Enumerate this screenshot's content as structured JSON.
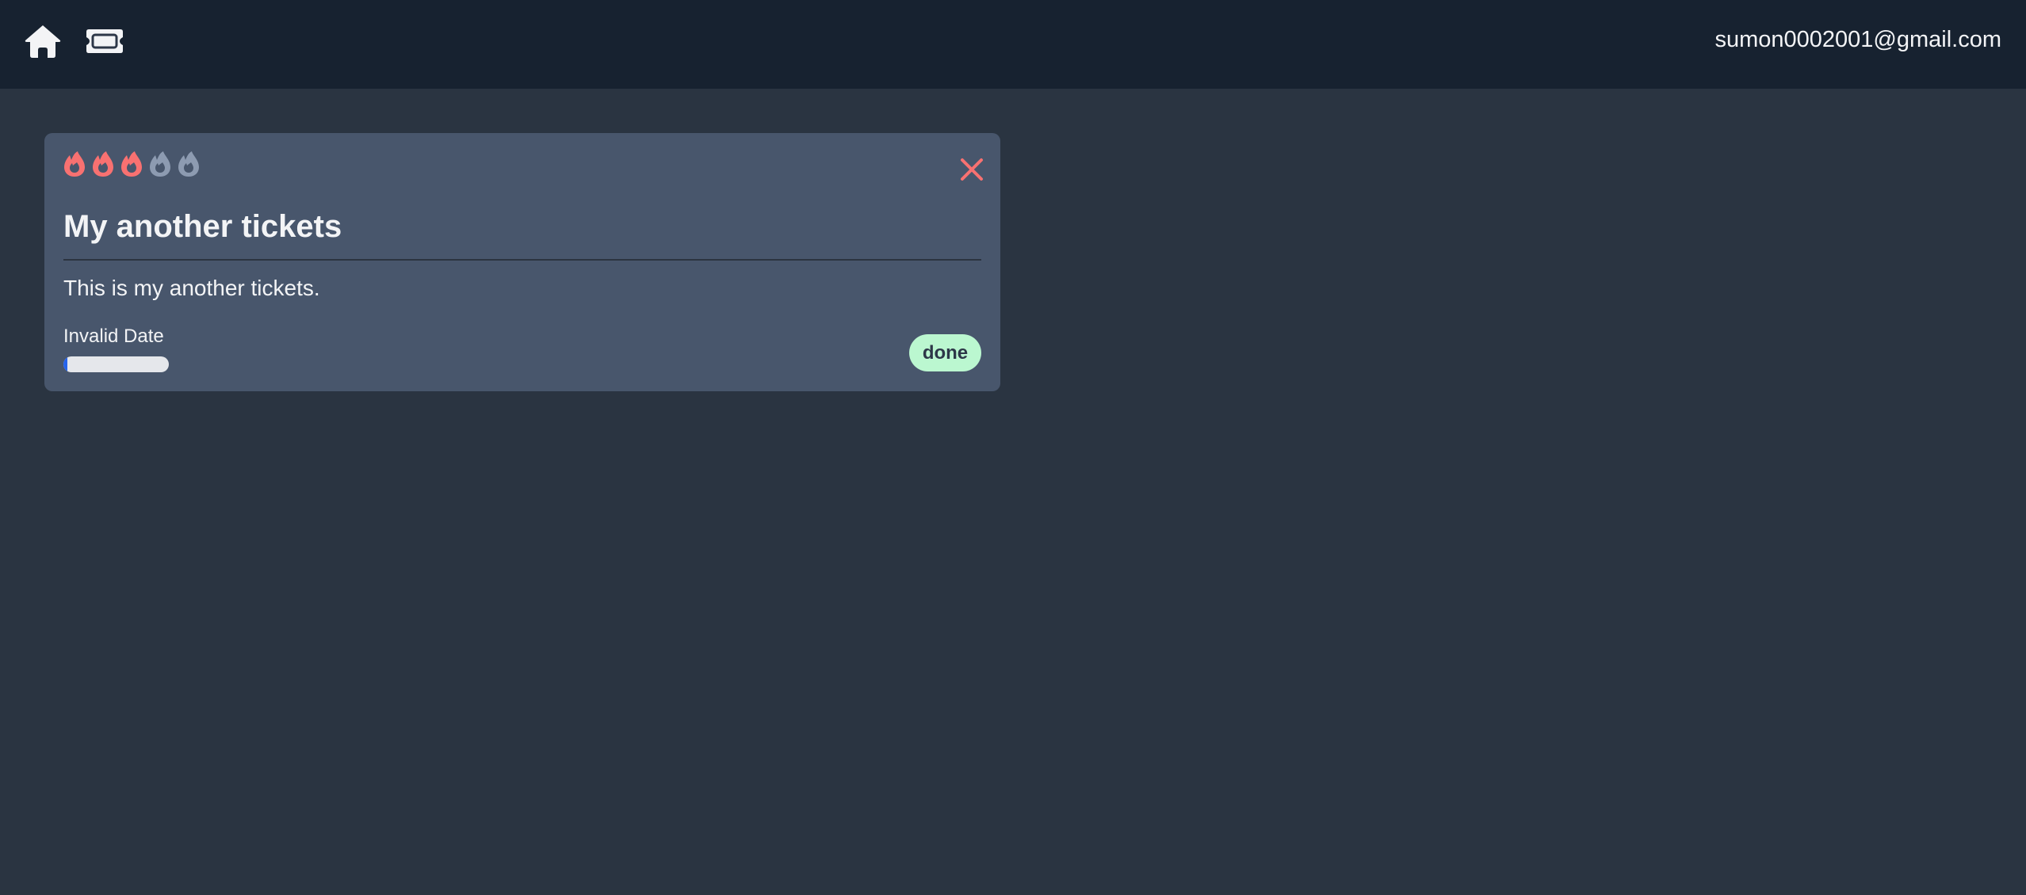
{
  "nav": {
    "home_icon": "home-icon",
    "ticket_icon": "ticket-icon",
    "user_email": "sumon0002001@gmail.com"
  },
  "ticket": {
    "priority": 3,
    "priority_max": 5,
    "priority_active_color": "#f87171",
    "priority_inactive_color": "#8d9bb1",
    "title": "My another tickets",
    "description": "This is my another tickets.",
    "date": "Invalid Date",
    "progress_percent": 4,
    "status": "done",
    "close_icon": "close-icon"
  }
}
